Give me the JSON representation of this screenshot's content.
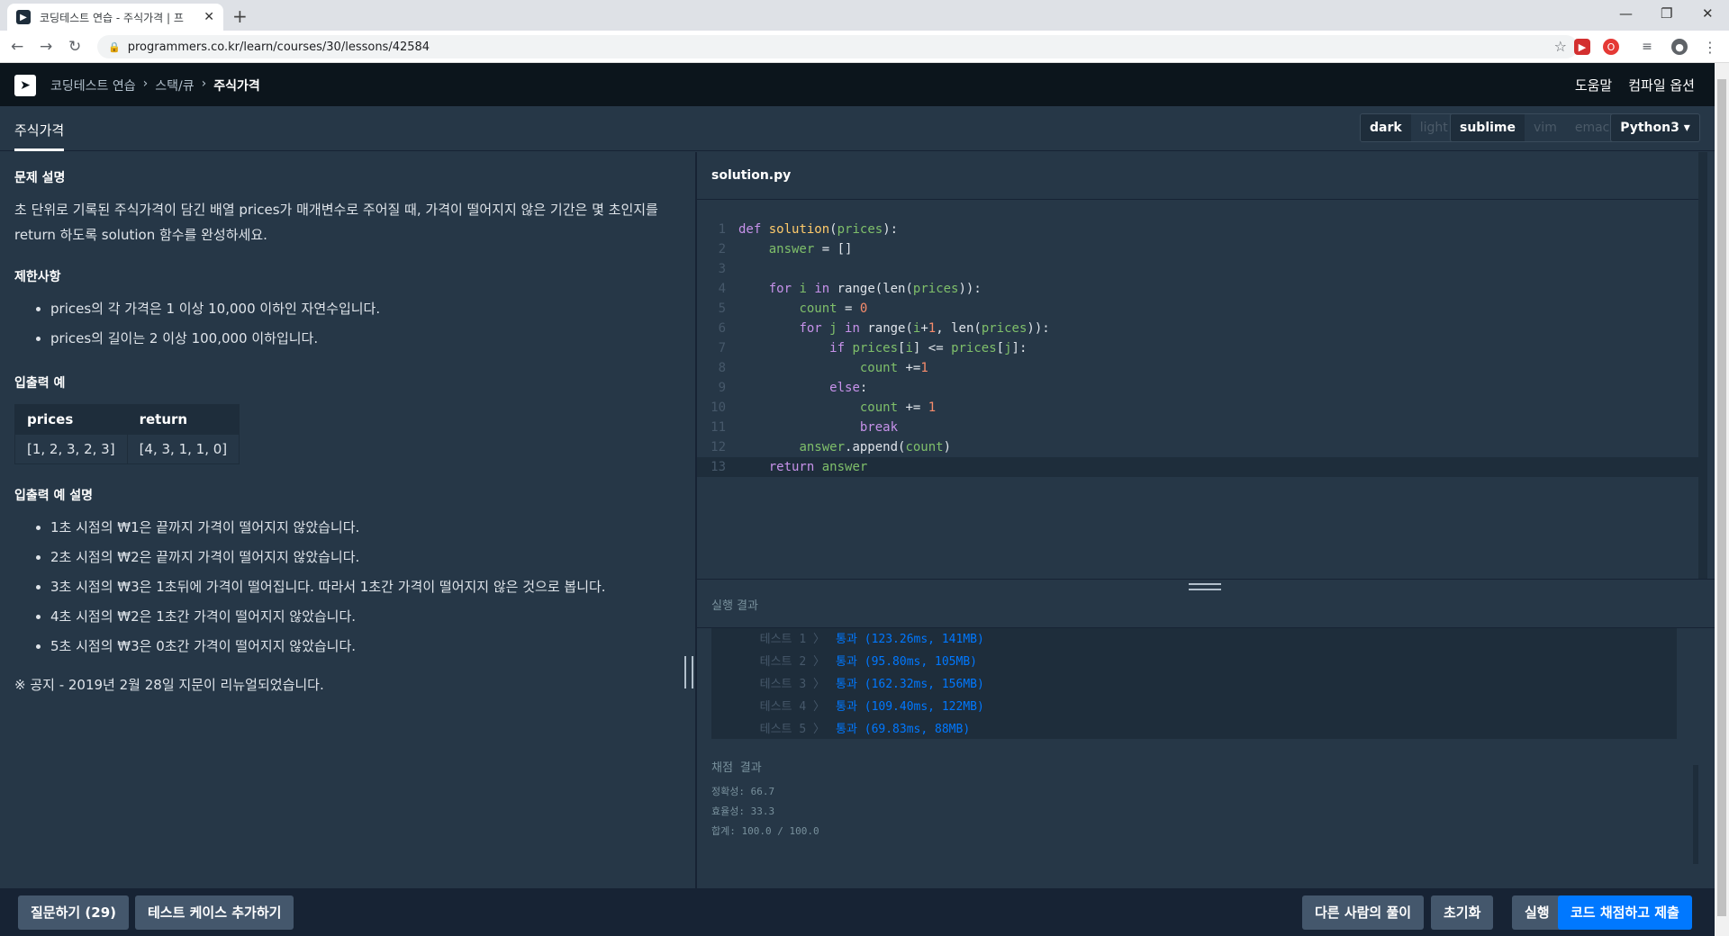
{
  "browser": {
    "tab_title": "코딩테스트 연습 - 주식가격 | 프",
    "url": "programmers.co.kr/learn/courses/30/lessons/42584"
  },
  "header": {
    "breadcrumb": [
      "코딩테스트 연습",
      "스택/큐",
      "주식가격"
    ],
    "help": "도움말",
    "compile_options": "컴파일 옵션"
  },
  "subheader": {
    "problem_tab": "주식가격",
    "themes": [
      "dark",
      "light"
    ],
    "keymaps": [
      "sublime",
      "vim",
      "emacs"
    ],
    "language": "Python3"
  },
  "problem": {
    "desc_title": "문제 설명",
    "desc_text": "초 단위로 기록된 주식가격이 담긴 배열 prices가 매개변수로 주어질 때, 가격이 떨어지지 않은 기간은 몇 초인지를 return 하도록 solution 함수를 완성하세요.",
    "limits_title": "제한사항",
    "limits": [
      "prices의 각 가격은 1 이상 10,000 이하인 자연수입니다.",
      "prices의 길이는 2 이상 100,000 이하입니다."
    ],
    "io_title": "입출력 예",
    "io_headers": [
      "prices",
      "return"
    ],
    "io_rows": [
      [
        "[1, 2, 3, 2, 3]",
        "[4, 3, 1, 1, 0]"
      ]
    ],
    "io_desc_title": "입출력 예 설명",
    "io_desc": [
      "1초 시점의 ₩1은 끝까지 가격이 떨어지지 않았습니다.",
      "2초 시점의 ₩2은 끝까지 가격이 떨어지지 않았습니다.",
      "3초 시점의 ₩3은 1초뒤에 가격이 떨어집니다. 따라서 1초간 가격이 떨어지지 않은 것으로 봅니다.",
      "4초 시점의 ₩2은 1초간 가격이 떨어지지 않았습니다.",
      "5초 시점의 ₩3은 0초간 가격이 떨어지지 않았습니다."
    ],
    "notice": "※ 공지 - 2019년 2월 28일 지문이 리뉴얼되었습니다."
  },
  "editor": {
    "filename": "solution.py",
    "line_numbers": [
      "1",
      "2",
      "3",
      "4",
      "5",
      "6",
      "7",
      "8",
      "9",
      "10",
      "11",
      "12",
      "13"
    ]
  },
  "results": {
    "title": "실행 결과",
    "tests": [
      {
        "label": "테스트 1 〉",
        "result": "통과 (123.26ms, 141MB)"
      },
      {
        "label": "테스트 2 〉",
        "result": "통과 (95.80ms, 105MB)"
      },
      {
        "label": "테스트 3 〉",
        "result": "통과 (162.32ms, 156MB)"
      },
      {
        "label": "테스트 4 〉",
        "result": "통과 (109.40ms, 122MB)"
      },
      {
        "label": "테스트 5 〉",
        "result": "통과 (69.83ms, 88MB)"
      }
    ],
    "score_title": "채점 결과",
    "accuracy": "정확성: 66.7",
    "efficiency": "효율성: 33.3",
    "total": "합계: 100.0 / 100.0"
  },
  "footer": {
    "question": "질문하기 (29)",
    "add_testcase": "테스트 케이스 추가하기",
    "others": "다른 사람의 풀이",
    "reset": "초기화",
    "run": "실행",
    "submit": "코드 채점하고 제출"
  }
}
